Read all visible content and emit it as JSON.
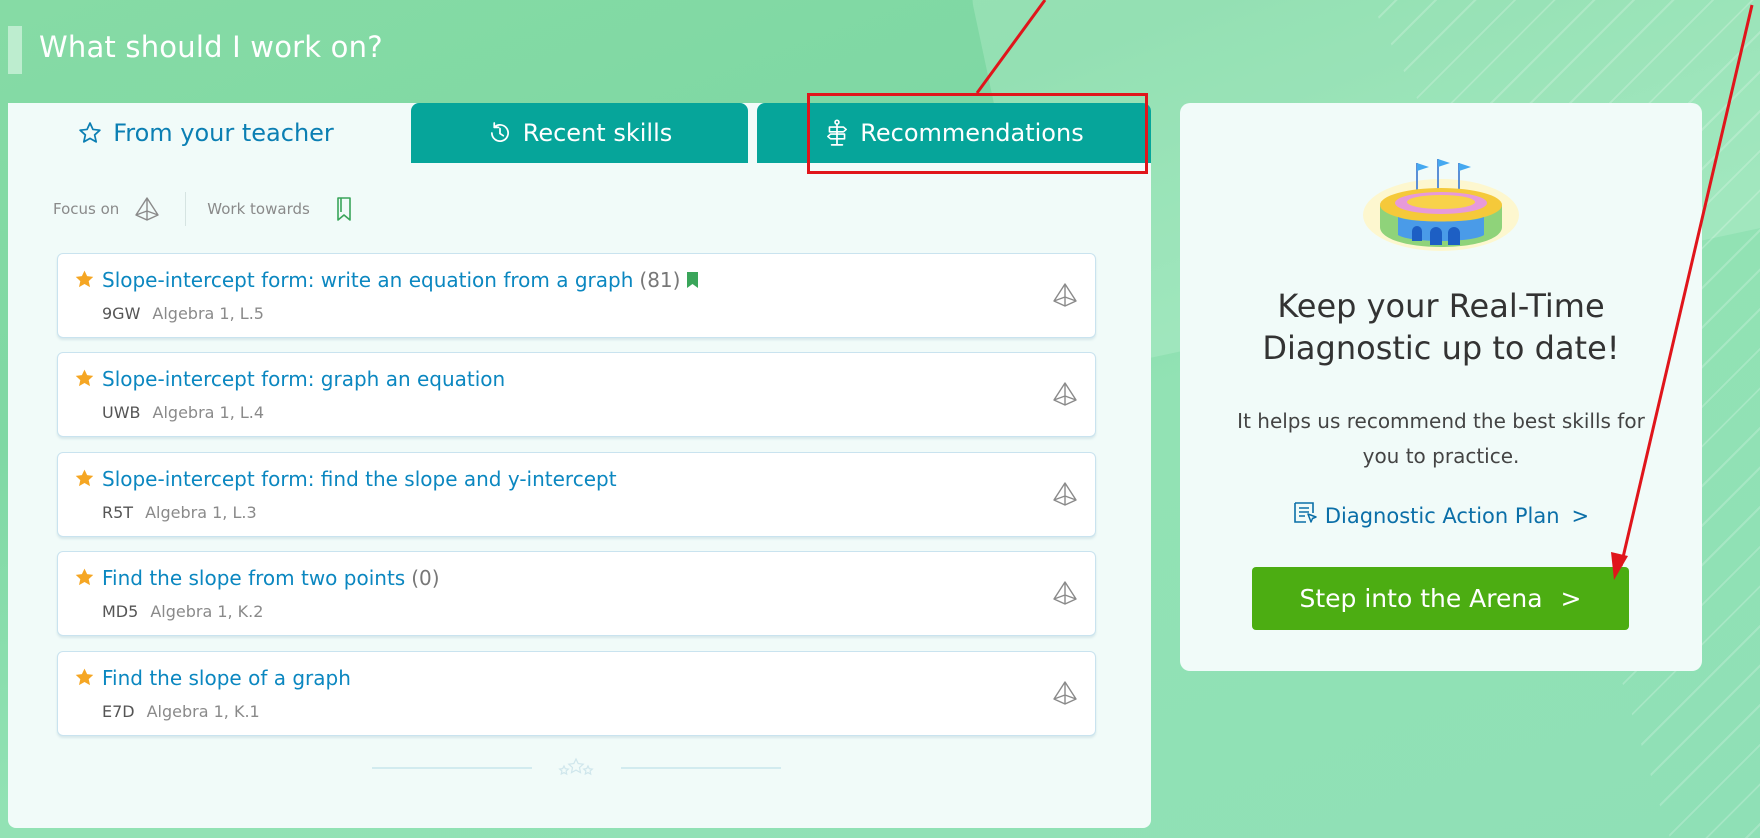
{
  "page": {
    "heading": "What should I work on?"
  },
  "tabs": [
    {
      "label": "From your teacher",
      "icon": "star-outline-icon",
      "active": true
    },
    {
      "label": "Recent skills",
      "icon": "history-clock-icon",
      "active": false
    },
    {
      "label": "Recommendations",
      "icon": "signpost-icon",
      "active": false
    }
  ],
  "filters": {
    "focus_label": "Focus on",
    "work_label": "Work towards",
    "focus_icon": "pyramid-icon",
    "work_icon": "bookmark-outline-icon"
  },
  "skills": [
    {
      "title": "Slope-intercept form: write an equation from a graph",
      "count": "(81)",
      "bookmarked": true,
      "code": "9GW",
      "grade": "Algebra 1, L.5"
    },
    {
      "title": "Slope-intercept form: graph an equation",
      "count": "",
      "bookmarked": false,
      "code": "UWB",
      "grade": "Algebra 1, L.4"
    },
    {
      "title": "Slope-intercept form: find the slope and y-intercept",
      "count": "",
      "bookmarked": false,
      "code": "R5T",
      "grade": "Algebra 1, L.3"
    },
    {
      "title": "Find the slope from two points",
      "count": "(0)",
      "bookmarked": false,
      "code": "MD5",
      "grade": "Algebra 1, K.2"
    },
    {
      "title": "Find the slope of a graph",
      "count": "",
      "bookmarked": false,
      "code": "E7D",
      "grade": "Algebra 1, K.1"
    }
  ],
  "diagnostic_card": {
    "title_line1": "Keep your Real-Time",
    "title_line2": "Diagnostic up to date!",
    "text_line1": "It helps us recommend the best skills for",
    "text_line2": "you to practice.",
    "plan_link": "Diagnostic Action Plan",
    "plan_chevron": ">",
    "button_label": "Step into the Arena",
    "button_chevron": ">"
  },
  "colors": {
    "tab_inactive": "#06a59a",
    "link_blue": "#0b87c0",
    "button_green": "#4cad12",
    "star_gold": "#f5a623",
    "annotation_red": "#e0151b"
  }
}
